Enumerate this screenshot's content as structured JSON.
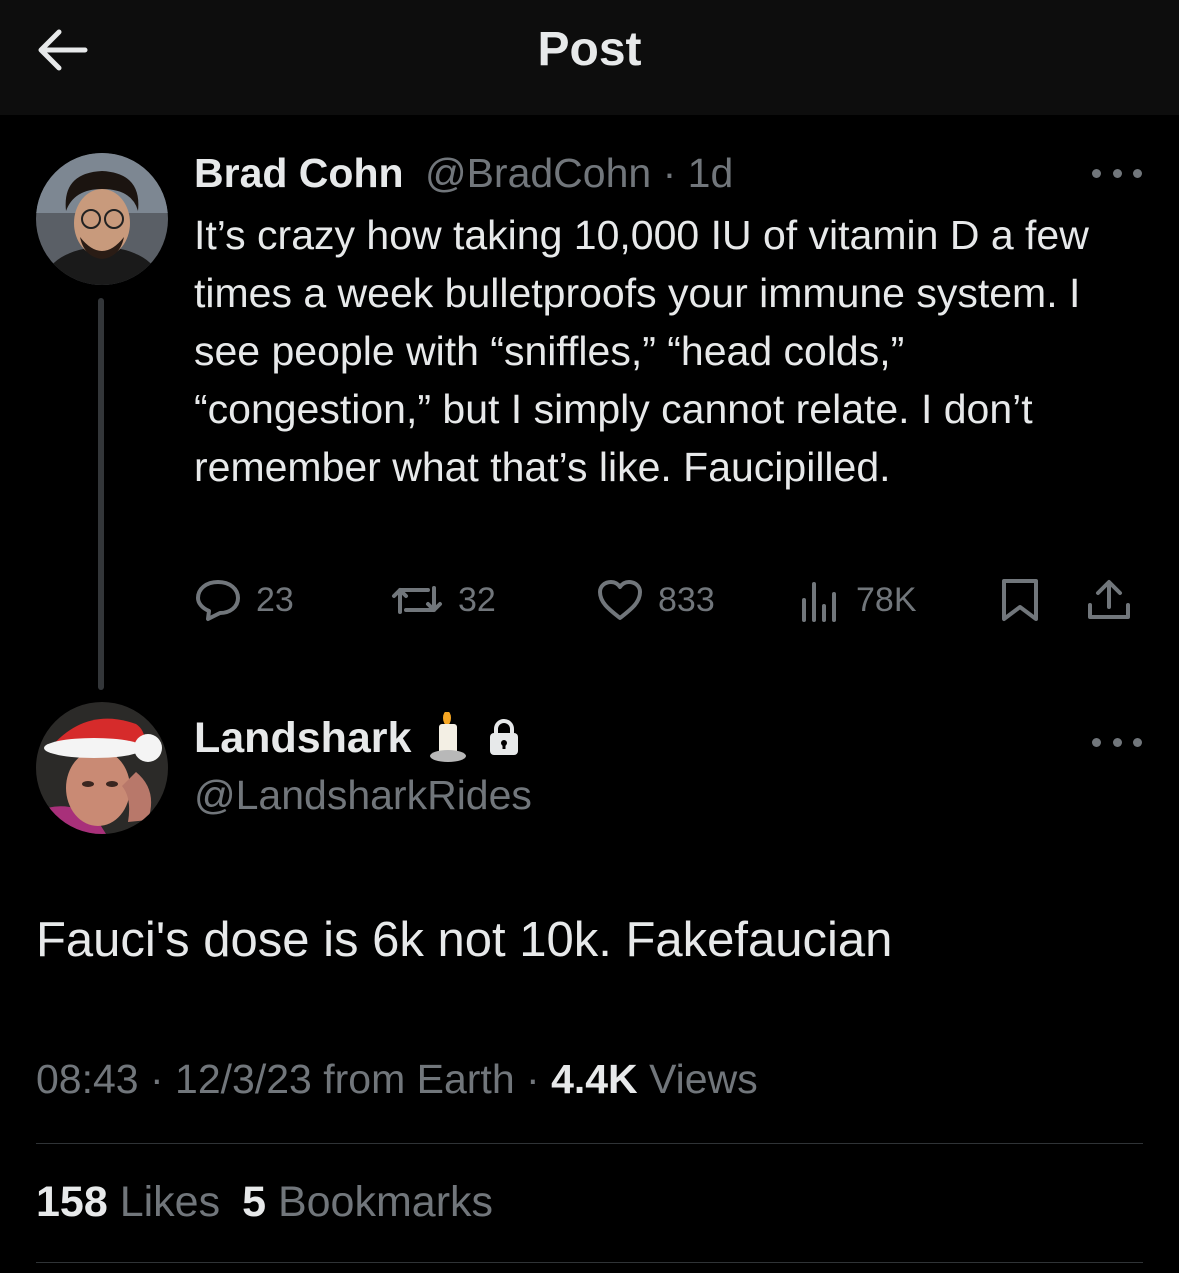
{
  "header": {
    "title": "Post"
  },
  "original": {
    "name": "Brad Cohn",
    "handle": "@BradCohn",
    "sep": " · ",
    "time": "1d",
    "text": "It’s crazy how taking 10,000 IU of vitamin D a few times a week bulletproofs your immune system. I see people with “sniffles,” “head colds,” “congestion,” but I simply cannot relate. I don’t remember what that’s like. Faucipilled.",
    "replies": "23",
    "reposts": "32",
    "likes": "833",
    "views": "78K"
  },
  "reply": {
    "name": "Landshark",
    "handle": "@LandsharkRides",
    "text": "Fauci's dose is 6k not 10k. Fakefaucian",
    "time": "08:43",
    "sep": " · ",
    "date": "12/3/23 from Earth",
    "views_count": "4.4K",
    "views_label": " Views",
    "likes_count": "158",
    "likes_label": " Likes",
    "bookmarks_count": "5",
    "bookmarks_label": " Bookmarks"
  },
  "icons": [
    "back-arrow-icon",
    "more-icon",
    "reply-icon",
    "repost-icon",
    "heart-icon",
    "views-icon",
    "bookmark-icon",
    "share-icon",
    "candle-icon",
    "lock-icon"
  ]
}
